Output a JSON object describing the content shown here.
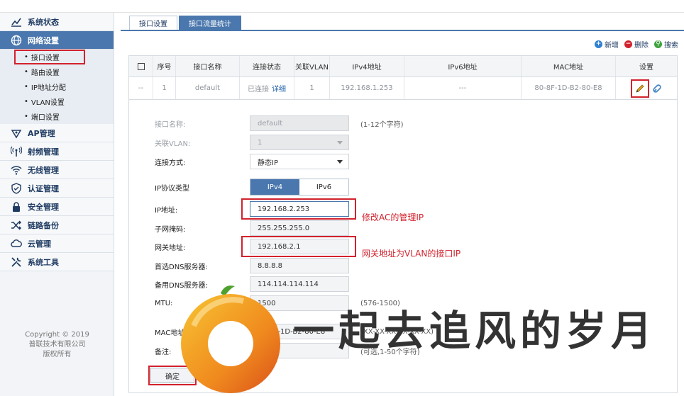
{
  "sidebar": {
    "items": [
      {
        "label": "系统状态",
        "icon": "chart-line-icon"
      },
      {
        "label": "网络设置",
        "icon": "globe-icon",
        "active": true
      },
      {
        "label": "AP管理",
        "icon": "ap-icon"
      },
      {
        "label": "射频管理",
        "icon": "radio-icon"
      },
      {
        "label": "无线管理",
        "icon": "wifi-icon"
      },
      {
        "label": "认证管理",
        "icon": "shield-check-icon"
      },
      {
        "label": "安全管理",
        "icon": "lock-icon"
      },
      {
        "label": "链路备份",
        "icon": "shuffle-icon"
      },
      {
        "label": "云管理",
        "icon": "cloud-icon"
      },
      {
        "label": "系统工具",
        "icon": "tools-icon"
      }
    ],
    "subitems": [
      "接口设置",
      "路由设置",
      "IP地址分配",
      "VLAN设置",
      "端口设置"
    ],
    "copyright": [
      "Copyright © 2019",
      "普联技术有限公司",
      "版权所有"
    ]
  },
  "tabs": [
    "接口设置",
    "接口流量统计"
  ],
  "toolbar": {
    "add": "新增",
    "delete": "删除",
    "search": "搜索"
  },
  "table": {
    "headers": [
      "",
      "序号",
      "接口名称",
      "连接状态",
      "关联VLAN",
      "IPv4地址",
      "IPv6地址",
      "MAC地址",
      "设置"
    ],
    "row": {
      "check": "--",
      "index": "1",
      "name": "default",
      "status": "已连接",
      "detail": "详细",
      "vlan": "1",
      "ipv4": "192.168.1.253",
      "ipv6": "---",
      "mac": "80-8F-1D-B2-80-E8"
    }
  },
  "form": {
    "name_label": "接口名称:",
    "name_value": "default",
    "name_hint": "(1-12个字符)",
    "vlan_label": "关联VLAN:",
    "vlan_value": "1",
    "mode_label": "连接方式:",
    "mode_value": "静态IP",
    "proto_label": "IP协议类型",
    "proto_v4": "IPv4",
    "proto_v6": "IPv6",
    "ip_label": "IP地址:",
    "ip_value": "192.168.2.253",
    "mask_label": "子网掩码:",
    "mask_value": "255.255.255.0",
    "gw_label": "网关地址:",
    "gw_value": "192.168.2.1",
    "dns1_label": "首选DNS服务器:",
    "dns1_value": "8.8.8.8",
    "dns2_label": "备用DNS服务器:",
    "dns2_value": "114.114.114.114",
    "mtu_label": "MTU:",
    "mtu_value": "1500",
    "mtu_hint": "(576-1500)",
    "mac_label": "MAC地址:",
    "mac_value": "80-8F-1D-B2-80-E8",
    "mac_hint": "(XX-XX-XX-XX-XX-XX)",
    "note_label": "备注:",
    "note_value": "",
    "note_hint": "(可选,1-50个字符)",
    "ok": "确定"
  },
  "annotations": {
    "ip": "修改AC的管理IP",
    "gw": "网关地址为VLAN的接口IP"
  },
  "watermark": "一起去追风的岁月",
  "colors": {
    "accent": "#4a77ad",
    "annotation": "#d2222d",
    "nav_text": "#1f3b62"
  }
}
